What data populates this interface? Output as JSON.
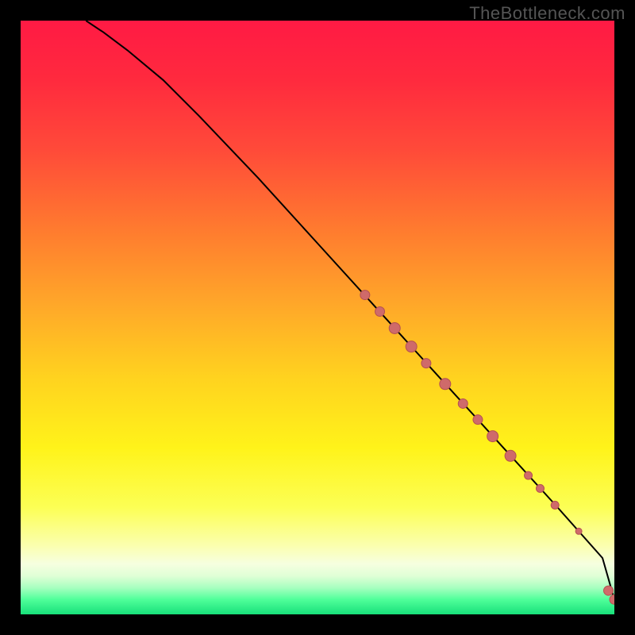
{
  "watermark": "TheBottleneck.com",
  "colors": {
    "background": "#000000",
    "gradient_stops": [
      {
        "offset": 0.0,
        "color": "#ff1a44"
      },
      {
        "offset": 0.1,
        "color": "#ff2a3e"
      },
      {
        "offset": 0.22,
        "color": "#ff4b39"
      },
      {
        "offset": 0.35,
        "color": "#ff7a2f"
      },
      {
        "offset": 0.48,
        "color": "#ffa829"
      },
      {
        "offset": 0.6,
        "color": "#ffd21f"
      },
      {
        "offset": 0.72,
        "color": "#fff31a"
      },
      {
        "offset": 0.82,
        "color": "#fcff55"
      },
      {
        "offset": 0.885,
        "color": "#fbffb0"
      },
      {
        "offset": 0.915,
        "color": "#f6ffe0"
      },
      {
        "offset": 0.935,
        "color": "#e0ffd6"
      },
      {
        "offset": 0.955,
        "color": "#a8ffc0"
      },
      {
        "offset": 0.975,
        "color": "#4fff9a"
      },
      {
        "offset": 1.0,
        "color": "#18e07a"
      }
    ],
    "curve": "#000000",
    "dot_fill": "#cf6a6a",
    "dot_stroke": "#b45151"
  },
  "chart_data": {
    "type": "line",
    "title": "",
    "xlabel": "",
    "ylabel": "",
    "xlim": [
      0,
      100
    ],
    "ylim": [
      0,
      100
    ],
    "series": [
      {
        "name": "curve",
        "x": [
          11,
          14,
          18,
          24,
          30,
          40,
          50,
          60,
          70,
          80,
          90,
          98,
          100
        ],
        "y": [
          100,
          98,
          95,
          90,
          84,
          73.5,
          62.5,
          51.5,
          40.5,
          29.5,
          18.5,
          9.5,
          2.5
        ]
      }
    ],
    "dots": [
      {
        "x": 58.0,
        "y": 53.8,
        "r": 6
      },
      {
        "x": 60.5,
        "y": 51.0,
        "r": 6
      },
      {
        "x": 63.0,
        "y": 48.2,
        "r": 7
      },
      {
        "x": 65.8,
        "y": 45.1,
        "r": 7
      },
      {
        "x": 68.3,
        "y": 42.3,
        "r": 6
      },
      {
        "x": 71.5,
        "y": 38.8,
        "r": 7
      },
      {
        "x": 74.5,
        "y": 35.5,
        "r": 6
      },
      {
        "x": 77.0,
        "y": 32.8,
        "r": 6
      },
      {
        "x": 79.5,
        "y": 30.0,
        "r": 7
      },
      {
        "x": 82.5,
        "y": 26.7,
        "r": 7
      },
      {
        "x": 85.5,
        "y": 23.4,
        "r": 5
      },
      {
        "x": 87.5,
        "y": 21.2,
        "r": 5
      },
      {
        "x": 90.0,
        "y": 18.4,
        "r": 5
      },
      {
        "x": 94.0,
        "y": 14.0,
        "r": 4
      },
      {
        "x": 99.0,
        "y": 4.0,
        "r": 6
      },
      {
        "x": 100.0,
        "y": 2.5,
        "r": 6
      }
    ]
  }
}
